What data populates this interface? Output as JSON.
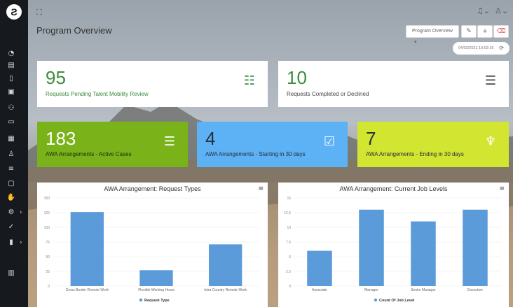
{
  "header": {
    "title": "Program Overview",
    "program_dropdown": "Program Overview",
    "date_time": "04/02/2021 10:53:16"
  },
  "cards": [
    {
      "value": "95",
      "label": "Requests Pending Talent Mobility Review",
      "icon": "contact-card-icon"
    },
    {
      "value": "10",
      "label": "Requests Completed or Declined",
      "icon": "contact-book-icon"
    },
    {
      "value": "183",
      "label": "AWA Arrangements - Active Cases",
      "icon": "list-icon"
    },
    {
      "value": "4",
      "label": "AWA Arrangements - Starting in 30 days",
      "icon": "calendar-check-icon"
    },
    {
      "value": "7",
      "label": "AWA Arrangements - Ending in 30 days",
      "icon": "shirt-icon"
    }
  ],
  "colors": {
    "sidebar": "#16191d",
    "card_green": "#79b319",
    "card_blue": "#5db1f5",
    "card_lime": "#d2e531",
    "bar": "#5b9bd9",
    "accent_red": "#d9534f"
  },
  "chart_data": [
    {
      "type": "bar",
      "title": "AWA Arrangement: Request Types",
      "categories": [
        "Cross Border Remote Work",
        "Flexible Working Hours",
        "Intra Country Remote Work"
      ],
      "series": [
        {
          "name": "Request Type",
          "values": [
            126,
            27,
            71
          ]
        }
      ],
      "ylim": [
        0,
        150
      ],
      "yticks": [
        0,
        25,
        50,
        75,
        100,
        125,
        150
      ],
      "legend": "bottom"
    },
    {
      "type": "bar",
      "title": "AWA Arrangement: Current Job Levels",
      "categories": [
        "Associate",
        "Manager",
        "Senior Manager",
        "Executive"
      ],
      "series": [
        {
          "name": "Count Of Job Level",
          "values": [
            6,
            13,
            11,
            13
          ]
        }
      ],
      "ylim": [
        0,
        15
      ],
      "yticks": [
        0,
        2.5,
        5,
        7.5,
        10,
        12.5,
        15
      ],
      "legend": "bottom"
    }
  ]
}
